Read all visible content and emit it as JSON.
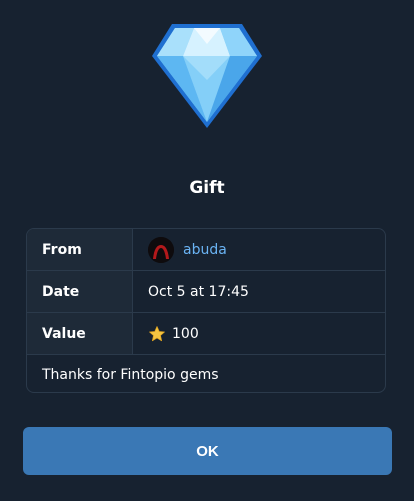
{
  "dialog": {
    "gem_icon": "diamond-gem-icon",
    "title": "Gift",
    "rows": {
      "from": {
        "label": "From",
        "value": "abuda",
        "avatar_icon": "user-avatar"
      },
      "date": {
        "label": "Date",
        "value": "Oct 5 at 17:45"
      },
      "value": {
        "label": "Value",
        "value": "100",
        "icon": "star-icon"
      }
    },
    "message": "Thanks for Fintopio gems",
    "ok_label": "OK"
  },
  "colors": {
    "background": "#172230",
    "label_cell": "#1e2a38",
    "border": "#2b3a4b",
    "link": "#6ab3f3",
    "button": "#3a78b5",
    "star": "#f5c542"
  }
}
